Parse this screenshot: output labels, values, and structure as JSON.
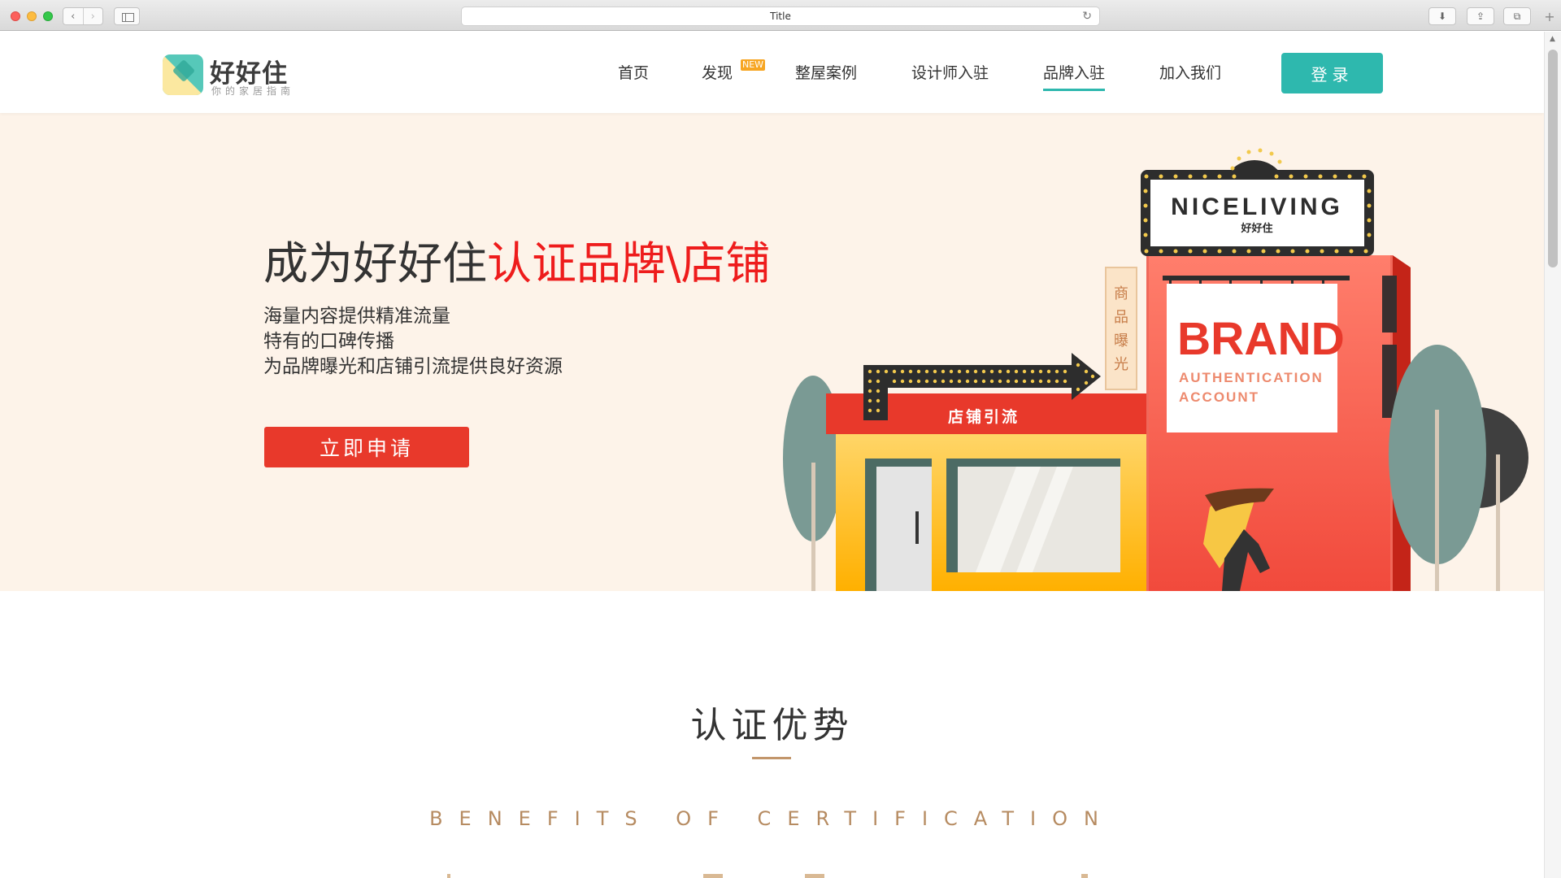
{
  "browser": {
    "tab_title": "Title",
    "nav_back": "‹",
    "nav_forward": "›",
    "reload_icon": "↻",
    "download_icon": "⬇",
    "share_icon": "⇪",
    "tabs_icon": "⧉",
    "new_tab_icon": "+"
  },
  "logo": {
    "title": "好好住",
    "subtitle": "你的家居指南"
  },
  "nav": {
    "home": "首页",
    "discover": "发现",
    "discover_badge": "NEW",
    "cases": "整屋案例",
    "designers": "设计师入驻",
    "brands": "品牌入驻",
    "join": "加入我们",
    "login": "登录"
  },
  "hero": {
    "title_prefix": "成为好好住",
    "title_highlight": "认证品牌\\店铺",
    "line1": "海量内容提供精准流量",
    "line2": "特有的口碑传播",
    "line3": "为品牌曝光和店铺引流提供良好资源",
    "apply": "立即申请"
  },
  "illustration": {
    "marquee_title": "NICELIVING",
    "marquee_sub": "好好住",
    "arrow_sign": "店铺引流",
    "vertical_sign": [
      "商",
      "品",
      "曝",
      "光"
    ],
    "brand": "BRAND",
    "brand_line1": "AUTHENTICATION",
    "brand_line2": "ACCOUNT"
  },
  "benefits": {
    "title": "认证优势",
    "subtitle": "BENEFITS OF CERTIFICATION"
  },
  "colors": {
    "teal": "#2eb8ae",
    "red": "#e8392b",
    "highlight_red": "#ee1c1c",
    "hero_bg": "#fdf3e9",
    "gold": "#b68b61"
  }
}
